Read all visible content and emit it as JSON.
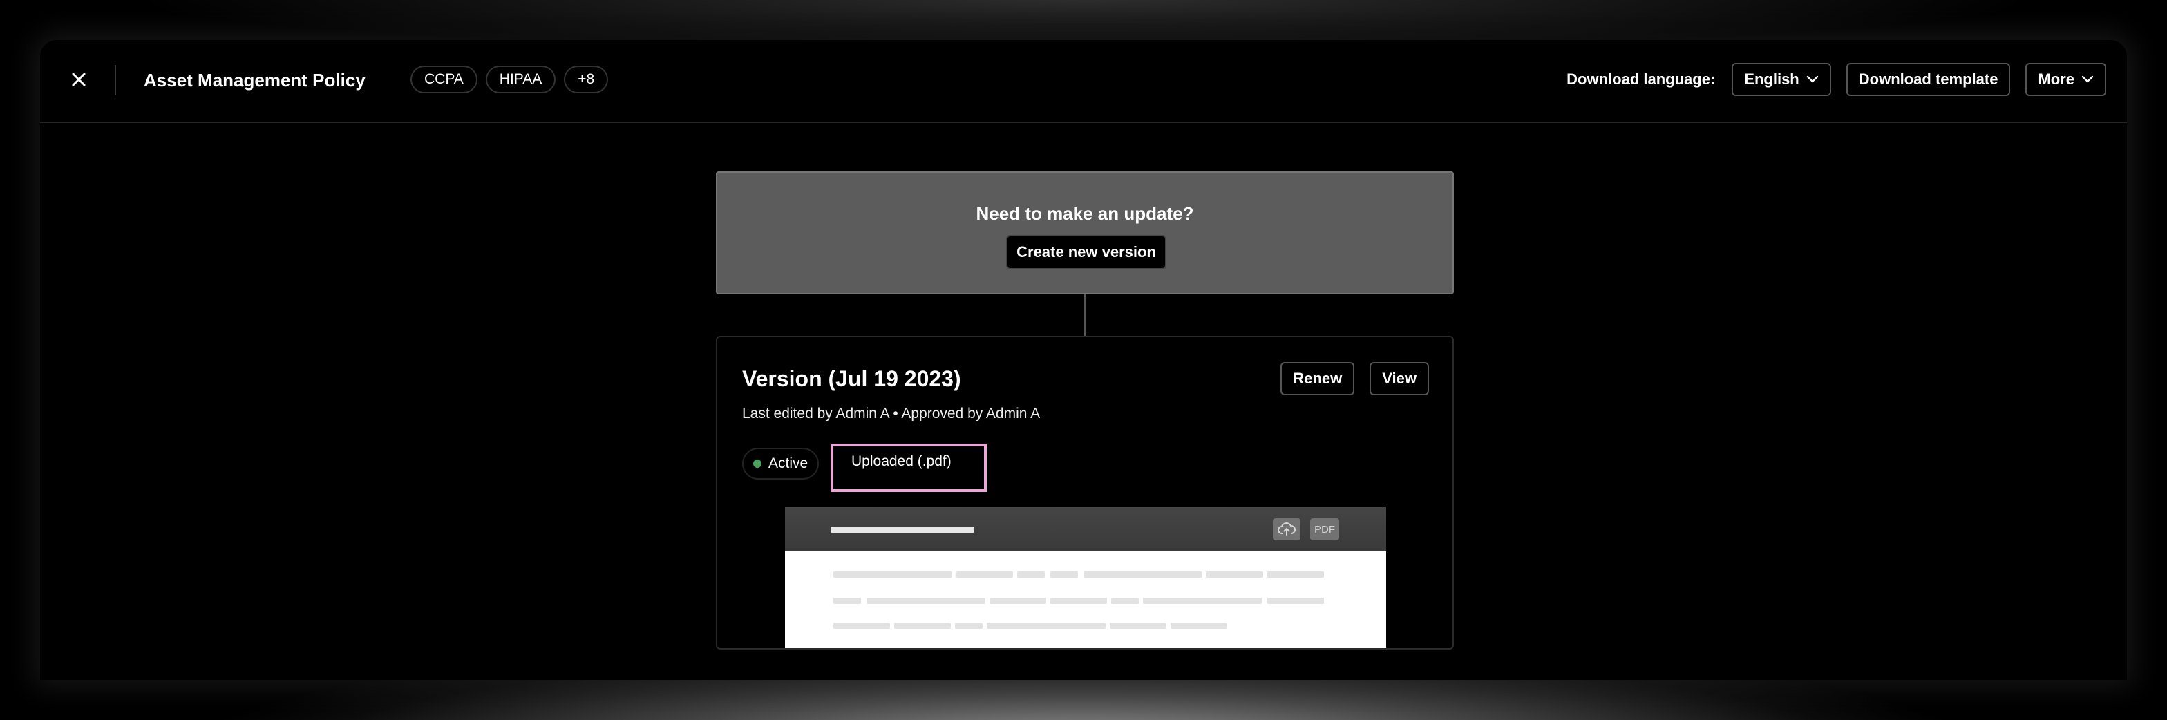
{
  "header": {
    "close_icon": "close-icon",
    "title": "Asset Management Policy",
    "tags": [
      "CCPA",
      "HIPAA",
      "+8"
    ],
    "download_language_label": "Download language:",
    "language": {
      "selected": "English",
      "icon": "chevron-down-icon"
    },
    "download_template_label": "Download template",
    "more": {
      "label": "More",
      "icon": "chevron-down-icon"
    }
  },
  "update_prompt": {
    "title": "Need to make an update?",
    "button_label": "Create new version"
  },
  "version": {
    "title": "Version (Jul 19 2023)",
    "meta": "Last edited by Admin A • Approved by Admin A",
    "renew_label": "Renew",
    "view_label": "View",
    "status": {
      "label": "Active",
      "color": "#4aa35e"
    },
    "source_label": "Uploaded (.pdf)",
    "highlight_color": "#e9a7d6",
    "preview": {
      "icons": [
        "cloud-upload-icon",
        "pdf-icon"
      ],
      "pdf_badge": "PDF"
    }
  }
}
